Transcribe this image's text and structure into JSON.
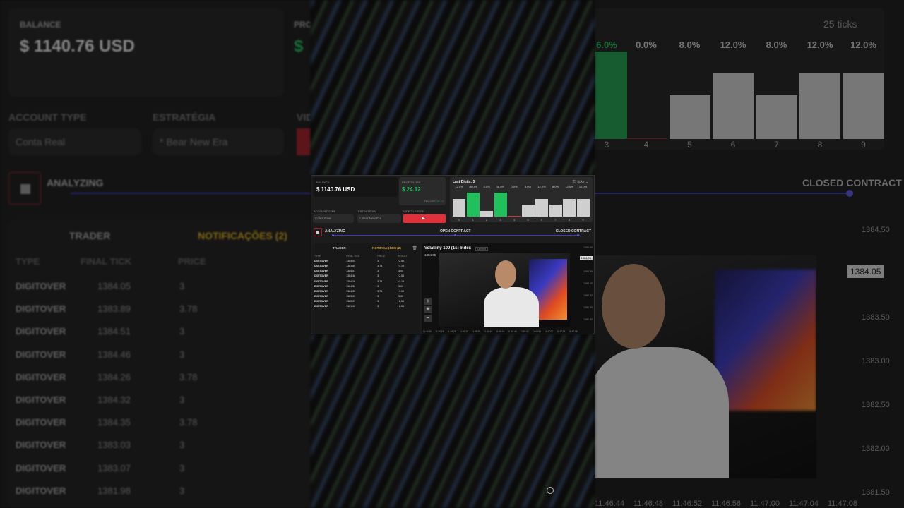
{
  "background": {
    "balance_label": "BALANCE",
    "balance_value": "$ 1140.76 USD",
    "profit_label": "PRO",
    "profit_value": "$",
    "ticks_select": "25 ticks",
    "percentages": [
      "6.0%",
      "0.0%",
      "8.0%",
      "12.0%",
      "8.0%",
      "12.0%",
      "12.0%"
    ],
    "digits": [
      "3",
      "4",
      "5",
      "6",
      "7",
      "8",
      "9"
    ],
    "account_type_label": "ACCOUNT TYPE",
    "account_type_value": "Conta Real",
    "strategy_label": "ESTRATÉGIA",
    "strategy_value": "* Bear New Era",
    "vid_label": "VID",
    "analyzing_label": "ANALYZING",
    "closed_contract": "CLOSED CONTRACT",
    "trader_tab": "TRADER",
    "notifications_tab": "NOTIFICAÇÕES (2)",
    "col_type": "TYPE",
    "col_final_tick": "FINAL TICK",
    "col_price": "PRICE",
    "rows": [
      {
        "type": "DIGITOVER",
        "tick": "1384.05",
        "price": "3"
      },
      {
        "type": "DIGITOVER",
        "tick": "1383.89",
        "price": "3.78"
      },
      {
        "type": "DIGITOVER",
        "tick": "1384.51",
        "price": "3"
      },
      {
        "type": "DIGITOVER",
        "tick": "1384.46",
        "price": "3"
      },
      {
        "type": "DIGITOVER",
        "tick": "1384.26",
        "price": "3.78"
      },
      {
        "type": "DIGITOVER",
        "tick": "1384.32",
        "price": "3"
      },
      {
        "type": "DIGITOVER",
        "tick": "1384.35",
        "price": "3.78"
      },
      {
        "type": "DIGITOVER",
        "tick": "1383.03",
        "price": "3"
      },
      {
        "type": "DIGITOVER",
        "tick": "1383.07",
        "price": "3"
      },
      {
        "type": "DIGITOVER",
        "tick": "1381.98",
        "price": "3"
      }
    ],
    "price_axis": [
      "1384.50",
      "1384.05",
      "1383.50",
      "1383.00",
      "1382.50",
      "1382.00",
      "1381.50"
    ],
    "time_axis": [
      "11:46:44",
      "11:46:48",
      "11:46:52",
      "11:46:56",
      "11:47:00",
      "11:47:04",
      "11:47:08"
    ]
  },
  "screen": {
    "balance_label": "BALANCE",
    "balance_value": "$ 1140.76 USD",
    "profit_label": "PROFIT/LOSS",
    "profit_value": "$ 24.12",
    "trades_label": "TRADES",
    "trades_value": "15",
    "trades_total": "7",
    "last_digits_title": "Last Digits: 5",
    "ticks_select": "25 ticks",
    "digit_bars": [
      {
        "digit": "0",
        "pct": "12.0%",
        "value": 12.0,
        "green": false
      },
      {
        "digit": "1",
        "pct": "16.0%",
        "value": 16.0,
        "green": true
      },
      {
        "digit": "2",
        "pct": "4.0%",
        "value": 4.0,
        "green": false
      },
      {
        "digit": "3",
        "pct": "16.0%",
        "value": 16.0,
        "green": true
      },
      {
        "digit": "4",
        "pct": "0.0%",
        "value": 0.0,
        "green": false
      },
      {
        "digit": "5",
        "pct": "8.0%",
        "value": 8.0,
        "green": false
      },
      {
        "digit": "6",
        "pct": "12.0%",
        "value": 12.0,
        "green": false
      },
      {
        "digit": "7",
        "pct": "8.0%",
        "value": 8.0,
        "green": false
      },
      {
        "digit": "8",
        "pct": "12.0%",
        "value": 12.0,
        "green": false
      },
      {
        "digit": "9",
        "pct": "12.0%",
        "value": 12.0,
        "green": false
      }
    ],
    "account_type_label": "ACCOUNT TYPE",
    "account_type_value": "Conta Real",
    "strategy_label": "ESTRATÉGIA",
    "strategy_value": "* Bear New Era",
    "video_label": "VIDEO LESSON",
    "analyzing": "ANALYZING",
    "open_contract": "OPEN CONTRACT",
    "closed_contract": "CLOSED CONTRACT",
    "trader_tab": "TRADER",
    "notifications_tab": "NOTIFICAÇÕES (2)",
    "col_type": "TYPE",
    "col_final_tick": "FINAL TICK",
    "col_price": "PRICE",
    "col_result": "RESULT",
    "rows": [
      {
        "type": "DIGITOVER",
        "tick": "1384.05",
        "price": "3",
        "result": "+2.54",
        "win": true
      },
      {
        "type": "DIGITOVER",
        "tick": "1383.89",
        "price": "3.78",
        "result": "+3.19",
        "win": true
      },
      {
        "type": "DIGITOVER",
        "tick": "1384.51",
        "price": "3",
        "result": "-3.00",
        "win": false
      },
      {
        "type": "DIGITOVER",
        "tick": "1384.46",
        "price": "3",
        "result": "+2.54",
        "win": true
      },
      {
        "type": "DIGITOVER",
        "tick": "1384.26",
        "price": "3.78",
        "result": "+3.19",
        "win": true
      },
      {
        "type": "DIGITOVER",
        "tick": "1384.32",
        "price": "3",
        "result": "-3.00",
        "win": false
      },
      {
        "type": "DIGITOVER",
        "tick": "1384.35",
        "price": "3.78",
        "result": "+3.19",
        "win": true
      },
      {
        "type": "DIGITOVER",
        "tick": "1383.03",
        "price": "3",
        "result": "-3.00",
        "win": false
      },
      {
        "type": "DIGITOVER",
        "tick": "1383.07",
        "price": "3",
        "result": "+2.54",
        "win": true
      },
      {
        "type": "DIGITOVER",
        "tick": "1381.98",
        "price": "3",
        "result": "+2.54",
        "win": true
      }
    ],
    "chart_title": "Volatility 100 (1s) Index",
    "chart_badge": "Derived",
    "chart_price": "1384.05",
    "chart_price_short": "1384.05",
    "price_axis": [
      "1384.50",
      "1384.05",
      "1383.50",
      "1383.00",
      "1382.50",
      "1382.00",
      "1381.50"
    ],
    "time_axis": [
      "11:46:20",
      "11:46:24",
      "11:46:28",
      "11:46:32",
      "11:46:36",
      "11:46:40",
      "11:46:44",
      "11:46:48",
      "11:46:52",
      "11:46:56",
      "11:47:00",
      "11:47:04",
      "11:47:08"
    ]
  },
  "colors": {
    "green": "#20c05c",
    "red": "#e0303a",
    "yellow": "#e3b020",
    "accent_line": "#3a3ac0"
  }
}
